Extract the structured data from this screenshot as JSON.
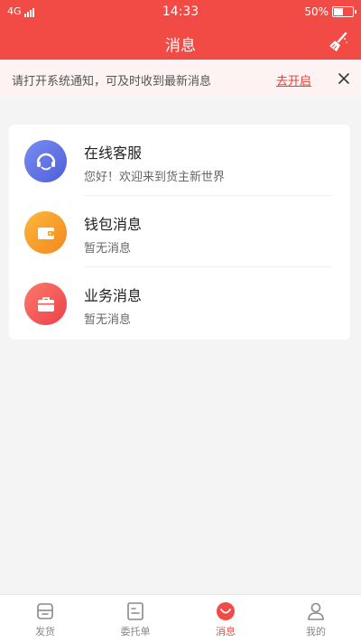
{
  "status_bar": {
    "network": "4G",
    "time": "14:33",
    "battery": "50%",
    "battery_level": 0.5
  },
  "nav": {
    "title": "消息"
  },
  "notice": {
    "text": "请打开系统通知，可及时收到最新消息",
    "link": "去开启"
  },
  "messages": [
    {
      "title": "在线客服",
      "subtitle": "您好！欢迎来到货主新世界",
      "icon": "customer-service-icon",
      "color_start": "#7a8cf3",
      "color_end": "#4e5fd8"
    },
    {
      "title": "钱包消息",
      "subtitle": "暂无消息",
      "icon": "wallet-icon",
      "color_start": "#fbb83a",
      "color_end": "#f5871f"
    },
    {
      "title": "业务消息",
      "subtitle": "暂无消息",
      "icon": "briefcase-icon",
      "color_start": "#fb7a6a",
      "color_end": "#ee3f4b"
    }
  ],
  "tabs": [
    {
      "label": "发货",
      "icon": "truck-icon"
    },
    {
      "label": "委托单",
      "icon": "order-icon"
    },
    {
      "label": "消息",
      "icon": "message-icon",
      "active": true
    },
    {
      "label": "我的",
      "icon": "user-icon"
    }
  ],
  "colors": {
    "brand": "#f24a45",
    "tab_inactive": "#888888"
  }
}
